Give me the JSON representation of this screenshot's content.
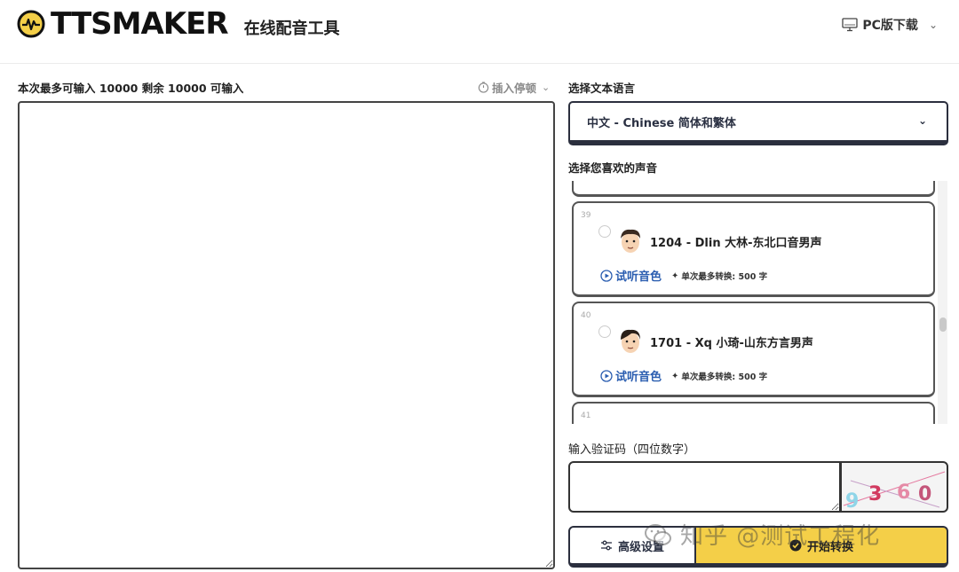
{
  "header": {
    "logo_text": "TTSMAKER",
    "logo_subtitle": "在线配音工具",
    "download_label": "PC版下载"
  },
  "editor": {
    "input_limit_label": "本次最多可输入 10000 剩余 10000 可输入",
    "insert_pause_label": "插入停顿",
    "text_value": ""
  },
  "language": {
    "section_label": "选择文本语言",
    "selected": "中文 - Chinese 简体和繁体"
  },
  "voices": {
    "section_label": "选择您喜欢的声音",
    "items": [
      {
        "index": "39",
        "name": "1204 - Dlin 大林-东北口音男声",
        "preview_label": "试听音色",
        "limit_label": "单次最多转换: 500 字"
      },
      {
        "index": "40",
        "name": "1701 - Xq 小琦-山东方言男声",
        "preview_label": "试听音色",
        "limit_label": "单次最多转换: 500 字"
      },
      {
        "index": "41"
      }
    ]
  },
  "captcha": {
    "label": "输入验证码（四位数字）",
    "value": "",
    "image_text": "9 3 6 0"
  },
  "actions": {
    "advanced_label": "高级设置",
    "start_label": "开始转换"
  },
  "watermark": {
    "text": "知乎 @测试工程化"
  },
  "colors": {
    "accent_yellow": "#f4cf48",
    "dark_border": "#2b2f3e",
    "link_blue": "#2a5db0"
  }
}
